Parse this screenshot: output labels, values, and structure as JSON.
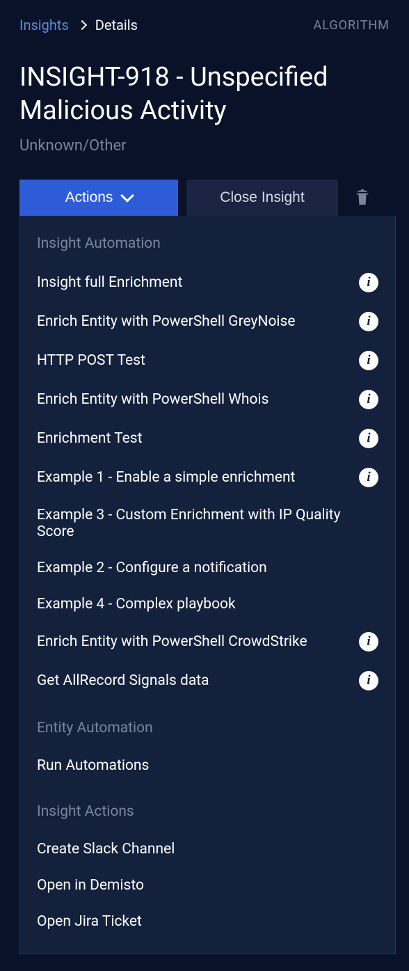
{
  "header": {
    "breadcrumb_link": "Insights",
    "breadcrumb_current": "Details",
    "algorithm_label": "ALGORITHM"
  },
  "title": "INSIGHT-918 - Unspecified Malicious Activity",
  "subtitle": "Unknown/Other",
  "buttons": {
    "actions": "Actions",
    "close_insight": "Close Insight"
  },
  "dropdown": {
    "sections": [
      {
        "header": "Insight Automation",
        "items": [
          {
            "label": "Insight full Enrichment",
            "has_info": true
          },
          {
            "label": "Enrich Entity with PowerShell GreyNoise",
            "has_info": true
          },
          {
            "label": "HTTP POST Test",
            "has_info": true
          },
          {
            "label": "Enrich Entity with PowerShell Whois",
            "has_info": true
          },
          {
            "label": "Enrichment Test",
            "has_info": true
          },
          {
            "label": "Example 1 - Enable a simple enrichment",
            "has_info": true
          },
          {
            "label": "Example 3 - Custom Enrichment with IP Quality Score",
            "has_info": false
          },
          {
            "label": "Example 2 - Configure a notification",
            "has_info": false
          },
          {
            "label": "Example 4 - Complex playbook",
            "has_info": false
          },
          {
            "label": "Enrich Entity with PowerShell CrowdStrike",
            "has_info": true
          },
          {
            "label": "Get AllRecord Signals data",
            "has_info": true
          }
        ]
      },
      {
        "header": "Entity Automation",
        "items": [
          {
            "label": "Run Automations",
            "has_info": false
          }
        ]
      },
      {
        "header": "Insight Actions",
        "items": [
          {
            "label": "Create Slack Channel",
            "has_info": false
          },
          {
            "label": "Open in Demisto",
            "has_info": false
          },
          {
            "label": "Open Jira Ticket",
            "has_info": false
          }
        ]
      }
    ]
  }
}
